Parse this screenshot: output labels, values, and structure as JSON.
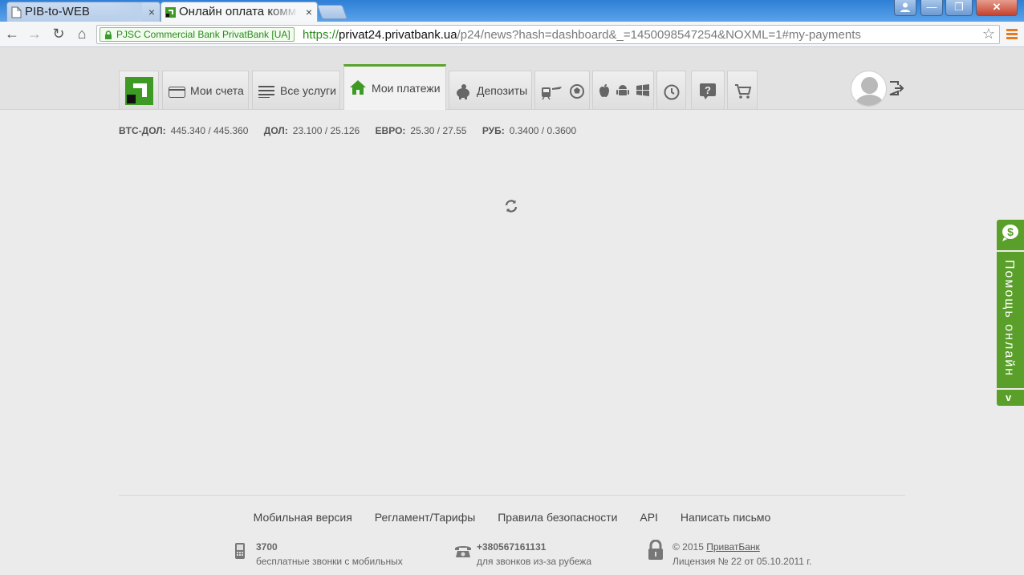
{
  "browser": {
    "tabs": [
      {
        "title": "PIB-to-WEB",
        "close": "×"
      },
      {
        "title": "Онлайн оплата комм",
        "close": "×"
      }
    ],
    "window_buttons": {
      "minimize": "—",
      "maximize": "❐",
      "close": "✕"
    },
    "nav": {
      "back": "←",
      "forward": "→",
      "reload": "↻",
      "home": "⌂"
    },
    "ev_certificate": "PJSC Commercial Bank PrivatBank [UA]",
    "url": {
      "scheme": "https://",
      "host": "privat24.privatbank.ua",
      "path": "/p24/news?hash=dashboard&_=1450098547254&NOXML=1#my-payments"
    },
    "star": "☆"
  },
  "nav": {
    "tabs": [
      {
        "label": "Мои счета",
        "icon": "card-icon"
      },
      {
        "label": "Все услуги",
        "icon": "list-icon"
      },
      {
        "label": "Мои платежи",
        "icon": "home-icon",
        "active": true
      },
      {
        "label": "Депозиты",
        "icon": "piggy-bank-icon"
      }
    ]
  },
  "rates": [
    {
      "code": "BTC-ДОЛ:",
      "value": "445.340 / 445.360"
    },
    {
      "code": "ДОЛ:",
      "value": "23.100 / 25.126"
    },
    {
      "code": "ЕВРО:",
      "value": "25.30 / 27.55"
    },
    {
      "code": "РУБ:",
      "value": "0.3400 / 0.3600"
    }
  ],
  "help": {
    "label": "Помощь онлайн",
    "collapse": "v"
  },
  "footer": {
    "links": [
      "Мобильная версия",
      "Регламент/Тарифы",
      "Правила безопасности",
      "API",
      "Написать письмо"
    ],
    "mobile": {
      "number": "3700",
      "caption": "бесплатные звонки с мобильных"
    },
    "abroad": {
      "number": "+380567161131",
      "caption": "для звонков из-за рубежа"
    },
    "copyright": {
      "prefix": "© 2015",
      "bank": "ПриватБанк",
      "license": "Лицензия № 22 от 05.10.2011 г."
    }
  },
  "colors": {
    "brand_green": "#5aa22f",
    "logo_green": "#3d9a23",
    "help_green": "#5a9f2a"
  }
}
